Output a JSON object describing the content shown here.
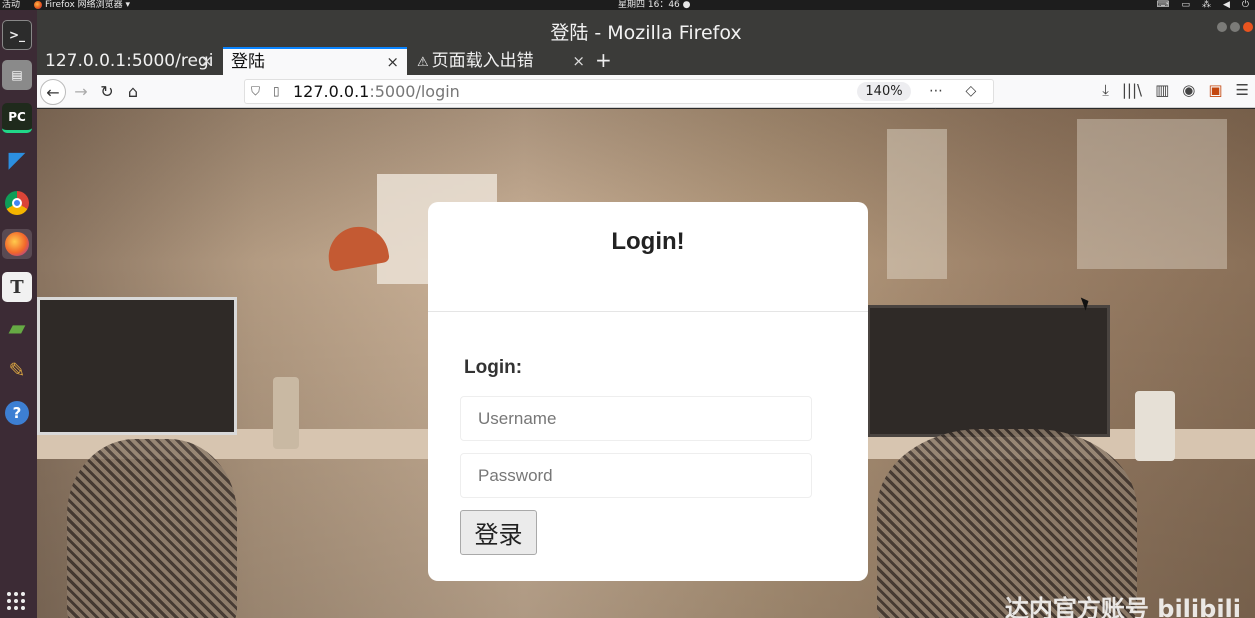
{
  "topbar": {
    "activities": "活动",
    "app_menu": "Firefox 网络浏览器 ▾",
    "clock": "星期四 16：46 ●"
  },
  "window": {
    "title": "登陆 - Mozilla Firefox"
  },
  "tabs": [
    {
      "label": "127.0.0.1:5000/regi",
      "close": "×"
    },
    {
      "label": "登陆",
      "close": "×"
    },
    {
      "label": "页面载入出错",
      "close": "×",
      "icon": "warning-icon"
    }
  ],
  "new_tab": "+",
  "navbar": {
    "back": "←",
    "forward": "→",
    "reload": "↻",
    "home": "⌂",
    "url_host": "127.0.0.1",
    "url_path": ":5000/login",
    "zoom": "140%",
    "page_actions": "⋯ ◇ ☆",
    "right_tools": [
      "⤓",
      "|||\\",
      "▥",
      "◉",
      "▣",
      "☰"
    ]
  },
  "login": {
    "title": "Login!",
    "form_label": "Login:",
    "username_placeholder": "Username",
    "password_placeholder": "Password",
    "submit": "登录"
  },
  "watermark": "达内官方账号 bilibili",
  "colors": {
    "accent": "#0a84ff",
    "dock": "#3c2b35",
    "titlebar": "#3b3b39"
  }
}
